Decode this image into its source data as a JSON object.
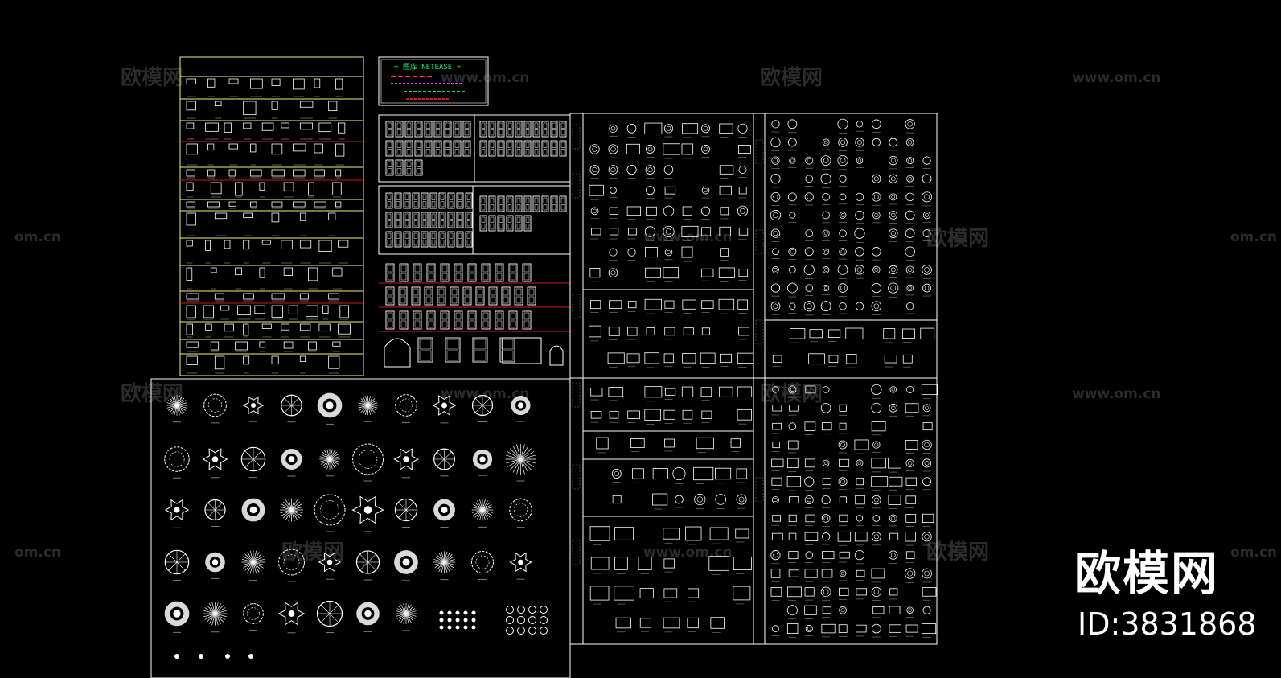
{
  "brand": {
    "name": "欧模网",
    "id_text": "ID:3831868"
  },
  "watermark": {
    "cn": "欧模网",
    "url": "www.om.cn",
    "url_short": "om.cn"
  },
  "title_block": {
    "heading": "= 图库 NETEASE ="
  },
  "colors": {
    "background": "#000000",
    "line": "#ffffff",
    "frame_yellow": "#f5f27a",
    "separator_red": "#d01818",
    "title_green": "#00e676",
    "title_red": "#ff3030"
  }
}
